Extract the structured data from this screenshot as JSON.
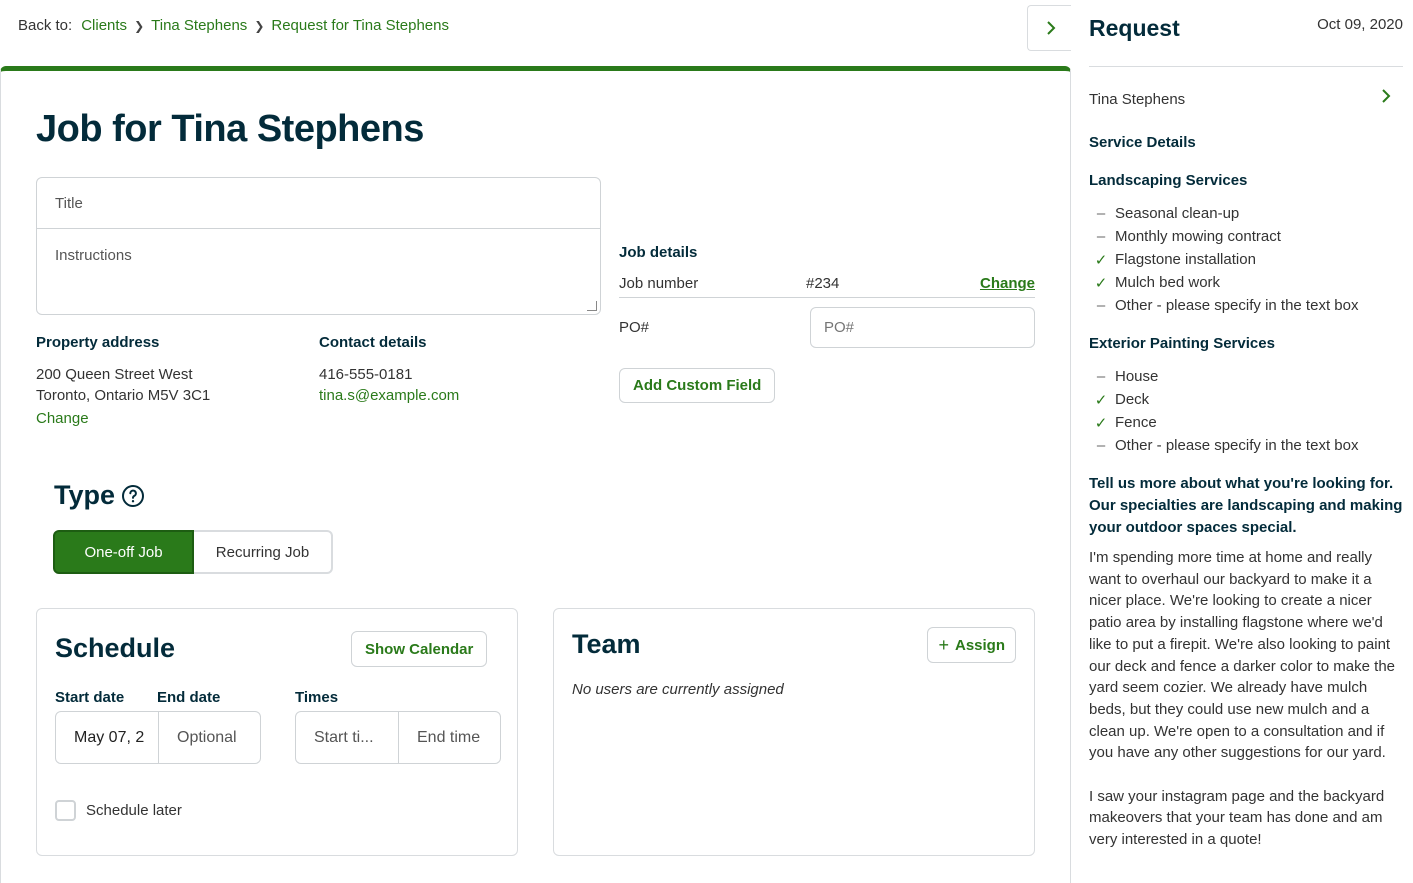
{
  "breadcrumb": {
    "prefix": "Back to:",
    "items": [
      "Clients",
      "Tina Stephens",
      "Request for Tina Stephens"
    ]
  },
  "page": {
    "title": "Job for Tina Stephens"
  },
  "job_form": {
    "title_placeholder": "Title",
    "instructions_placeholder": "Instructions"
  },
  "property": {
    "label": "Property address",
    "line1": "200 Queen Street West",
    "line2": "Toronto, Ontario M5V 3C1",
    "change": "Change"
  },
  "contact": {
    "label": "Contact details",
    "phone": "416-555-0181",
    "email": "tina.s@example.com"
  },
  "job_details": {
    "label": "Job details",
    "job_number_label": "Job number",
    "job_number": "#234",
    "change": "Change",
    "po_label": "PO#",
    "po_placeholder": "PO#",
    "add_custom_field": "Add Custom Field"
  },
  "type": {
    "label": "Type",
    "options": [
      "One-off Job",
      "Recurring Job"
    ],
    "selected": "One-off Job"
  },
  "schedule": {
    "title": "Schedule",
    "show_calendar": "Show Calendar",
    "start_date_label": "Start date",
    "end_date_label": "End date",
    "times_label": "Times",
    "start_date_value": "May 07, 2",
    "end_date_placeholder": "Optional",
    "start_time_placeholder": "Start ti...",
    "end_time_placeholder": "End time",
    "schedule_later": "Schedule later"
  },
  "team": {
    "title": "Team",
    "assign": "Assign",
    "empty": "No users are currently assigned"
  },
  "sidebar": {
    "title": "Request",
    "date": "Oct 09, 2020",
    "client": "Tina Stephens",
    "service_details": "Service Details",
    "landscaping": {
      "heading": "Landscaping Services",
      "items": [
        {
          "label": "Seasonal clean-up",
          "checked": false
        },
        {
          "label": "Monthly mowing contract",
          "checked": false
        },
        {
          "label": "Flagstone installation",
          "checked": true
        },
        {
          "label": "Mulch bed work",
          "checked": true
        },
        {
          "label": "Other - please specify in the text box",
          "checked": false
        }
      ]
    },
    "painting": {
      "heading": "Exterior Painting Services",
      "items": [
        {
          "label": "House",
          "checked": false
        },
        {
          "label": "Deck",
          "checked": true
        },
        {
          "label": "Fence",
          "checked": true
        },
        {
          "label": "Other - please specify in the text box",
          "checked": false
        }
      ]
    },
    "question": "Tell us more about what you're looking for. Our specialties are landscaping and making your outdoor spaces special.",
    "answer_p1": "I'm spending more time at home and really want to overhaul our backyard to make it a nicer place. We're looking to create a nicer patio area by installing flagstone where we'd like to put a firepit. We're also looking to paint our deck and fence a darker color to make the yard seem cozier. We already have mulch beds, but they could use new mulch and a clean up. We're open to a consultation and if you have any other suggestions for our yard.",
    "answer_p2": "I saw your instagram page and the backyard makeovers that your team has done and am very interested in a quote!"
  },
  "colors": {
    "accent": "#2a7a1a",
    "heading": "#032b3a",
    "border": "#d9dcdf"
  }
}
